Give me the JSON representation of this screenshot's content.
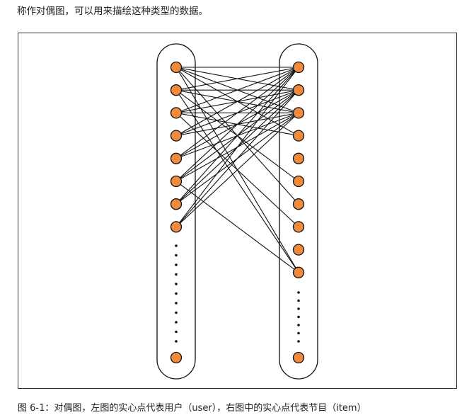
{
  "page": {
    "intro_text": "称作对偶图，可以用来描绘这种类型的数据。",
    "caption": "图 6-1：对偶图，左图的实心点代表用户（user），右图中的实心点代表节目（item）"
  },
  "graph": {
    "node_fill": "#f08a3c",
    "node_stroke": "#111111",
    "left_nodes": 8,
    "right_nodes": 10,
    "edges": [
      [
        0,
        0
      ],
      [
        0,
        1
      ],
      [
        0,
        2
      ],
      [
        0,
        3
      ],
      [
        0,
        6
      ],
      [
        0,
        9
      ],
      [
        1,
        0
      ],
      [
        1,
        1
      ],
      [
        1,
        2
      ],
      [
        1,
        5
      ],
      [
        1,
        9
      ],
      [
        2,
        0
      ],
      [
        2,
        1
      ],
      [
        2,
        2
      ],
      [
        2,
        3
      ],
      [
        2,
        7
      ],
      [
        3,
        0
      ],
      [
        3,
        1
      ],
      [
        3,
        2
      ],
      [
        4,
        0
      ],
      [
        4,
        1
      ],
      [
        4,
        2
      ],
      [
        5,
        0
      ],
      [
        5,
        1
      ],
      [
        5,
        2
      ],
      [
        5,
        9
      ],
      [
        6,
        0
      ],
      [
        6,
        1
      ],
      [
        6,
        2
      ],
      [
        7,
        0
      ],
      [
        7,
        1
      ],
      [
        7,
        2
      ]
    ]
  }
}
